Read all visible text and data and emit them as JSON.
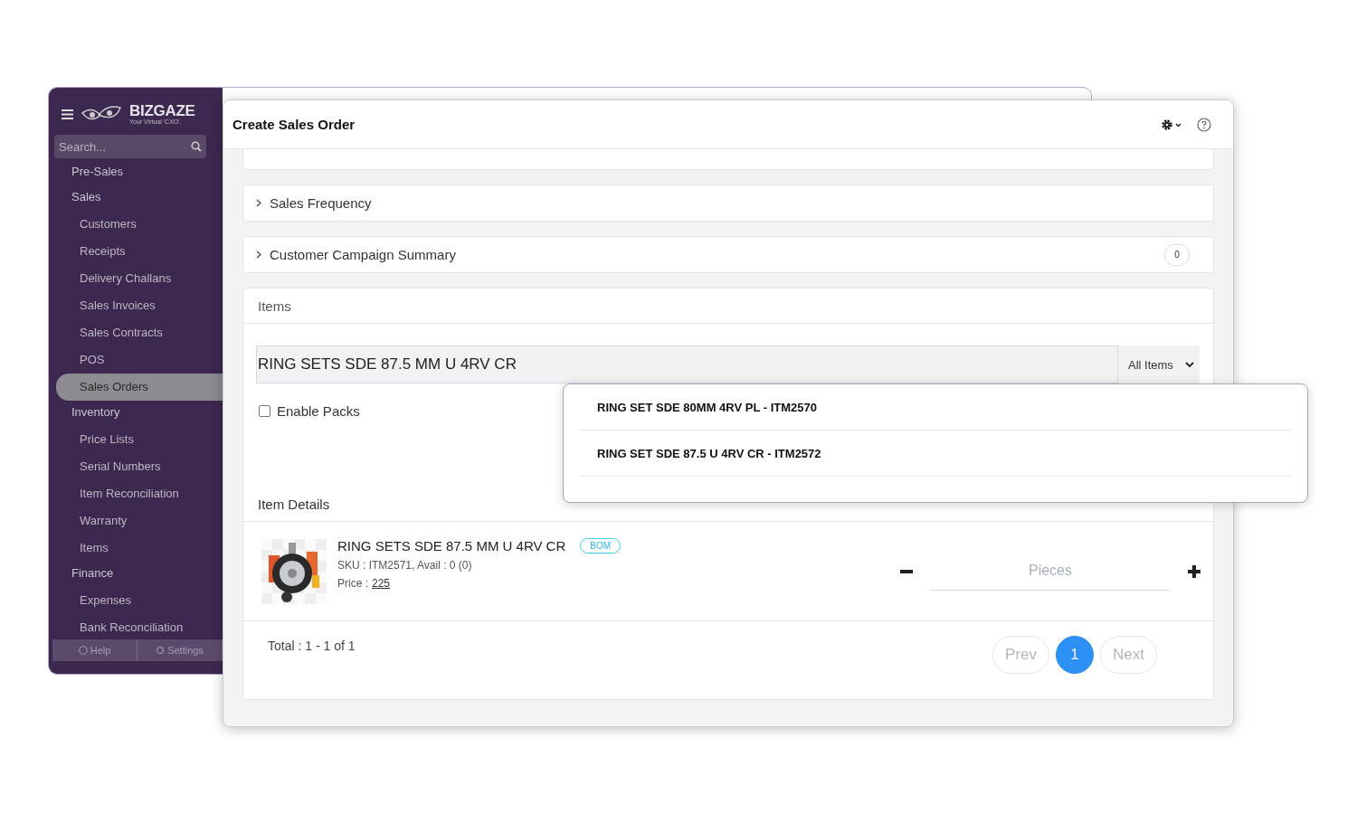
{
  "back_window": {
    "logo": {
      "name": "BIZGAZE",
      "tagline": "Your Virtual 'CXO'."
    },
    "search": {
      "placeholder": "Search..."
    },
    "nav": [
      {
        "label": "Pre-Sales"
      },
      {
        "label": "Sales",
        "children": [
          {
            "label": "Customers",
            "selected": false
          },
          {
            "label": "Receipts",
            "selected": false
          },
          {
            "label": "Delivery Challans",
            "selected": false
          },
          {
            "label": "Sales Invoices",
            "selected": false
          },
          {
            "label": "Sales Contracts",
            "selected": false
          },
          {
            "label": "POS",
            "selected": false
          },
          {
            "label": "Sales Orders",
            "selected": true
          }
        ]
      },
      {
        "label": "Inventory",
        "children": [
          {
            "label": "Price Lists",
            "selected": false
          },
          {
            "label": "Serial Numbers",
            "selected": false
          },
          {
            "label": "Item Reconciliation",
            "selected": false
          },
          {
            "label": "Warranty",
            "selected": false
          },
          {
            "label": "Items",
            "selected": false
          }
        ]
      },
      {
        "label": "Finance",
        "children": [
          {
            "label": "Expenses",
            "selected": false
          },
          {
            "label": "Bank Reconciliation",
            "selected": false
          }
        ]
      }
    ],
    "footer": [
      "Help",
      "Settings"
    ]
  },
  "dialog": {
    "title": "Create Sales Order",
    "sections": [
      {
        "title": "Sales Frequency",
        "expanded": false
      },
      {
        "title": "Customer Campaign Summary",
        "expanded": false,
        "count": "0"
      }
    ],
    "items": {
      "title": "Items",
      "search": {
        "value": "RING SETS SDE 87.5 MM U 4RV CR"
      },
      "filter": "All Items",
      "enable_packs": {
        "label": "Enable Packs",
        "checked": false
      },
      "details_title": "Item Details",
      "rows": [
        {
          "name": "RING SETS SDE 87.5 MM U 4RV CR",
          "badge": "BOM",
          "sku": "SKU : ITM2571, Avail : 0 (0)",
          "price_label": "Price :",
          "price": "225",
          "qty_placeholder": "Pieces"
        }
      ],
      "total": "Total : 1 - 1 of 1",
      "pagination": {
        "prev": "Prev",
        "pages": [
          {
            "label": "1",
            "selected": true
          }
        ],
        "next": "Next"
      }
    }
  },
  "suggestions": [
    {
      "label": "RING SET SDE 80MM 4RV PL - ITM2570"
    },
    {
      "label": "RING SET SDE 87.5 U 4RV CR - ITM2572"
    }
  ]
}
